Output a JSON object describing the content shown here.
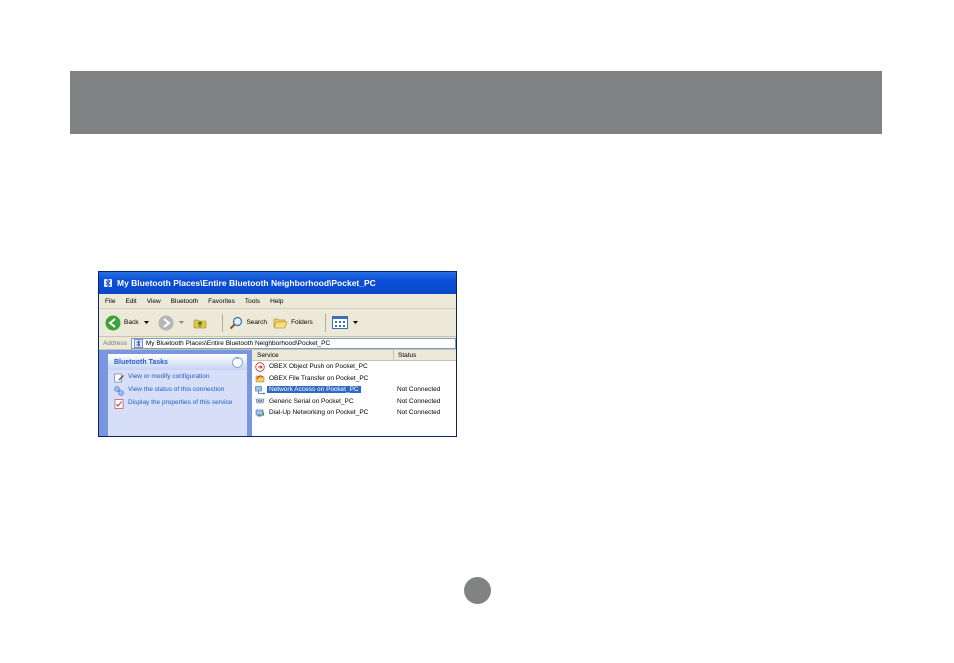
{
  "window": {
    "title": "My Bluetooth Places\\Entire Bluetooth Neighborhood\\Pocket_PC"
  },
  "menu": [
    "File",
    "Edit",
    "View",
    "Bluetooth",
    "Favorites",
    "Tools",
    "Help"
  ],
  "toolbar": {
    "back_label": "Back",
    "search_label": "Search",
    "folders_label": "Folders"
  },
  "address": {
    "label": "Address",
    "value": "My Bluetooth Places\\Entire Bluetooth Neighborhood\\Pocket_PC"
  },
  "tasks": {
    "title": "Bluetooth Tasks",
    "items": [
      {
        "label": "View or modify configuration",
        "icon": "configure-icon"
      },
      {
        "label": "View the status of this connection",
        "icon": "status-icon"
      },
      {
        "label": "Display the properties of this service",
        "icon": "properties-icon"
      }
    ]
  },
  "list": {
    "columns": [
      "Service",
      "Status"
    ],
    "rows": [
      {
        "service": "OBEX Object Push on Pocket_PC",
        "status": "",
        "icon": "obex-push-icon"
      },
      {
        "service": "OBEX File Transfer on Pocket_PC",
        "status": "",
        "icon": "obex-file-icon"
      },
      {
        "service": "Network Access on Pocket_PC",
        "status": "Not Connected",
        "icon": "network-access-icon",
        "selected": true
      },
      {
        "service": "Generic Serial on Pocket_PC",
        "status": "Not Connected",
        "icon": "serial-icon"
      },
      {
        "service": "Dial-Up Networking on Pocket_PC",
        "status": "Not Connected",
        "icon": "dialup-icon"
      }
    ]
  },
  "colors": {
    "header_bar": "#808284",
    "titlebar": "#0b4fd8",
    "selection": "#316ac5",
    "task_link": "#215dc6"
  }
}
